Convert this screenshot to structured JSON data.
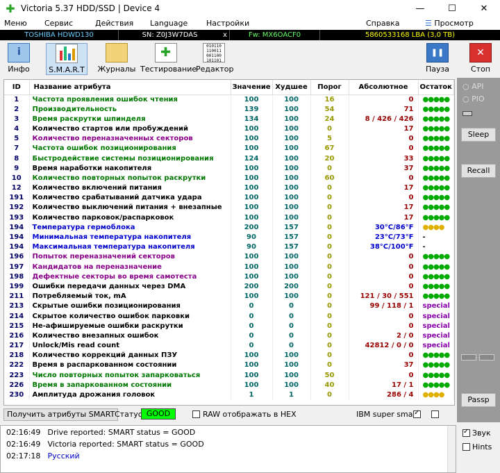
{
  "window": {
    "title": "Victoria 5.37 HDD/SSD | Device 4",
    "minimize": "—",
    "maximize": "☐",
    "close": "✕"
  },
  "menu": {
    "items": [
      "Меню",
      "Сервис",
      "Действия",
      "Language",
      "Настройки",
      "Справка"
    ],
    "buffer_view": "Просмотр буфера"
  },
  "info": {
    "model": "TOSHIBA HDWD130",
    "serial": "SN: Z0J3W7DAS",
    "x": "x",
    "firmware": "Fw: MX6OACF0",
    "lba": "5860533168 LBA (3,0 TB)"
  },
  "toolbar": {
    "info": "Инфо",
    "smart": "S.M.A.R.T",
    "logs": "Журналы",
    "testing": "Тестирование",
    "editor": "Редактор",
    "pause": "Пауза",
    "stop": "Стоп"
  },
  "table": {
    "headers": [
      "ID",
      "Название атрибута",
      "Значение",
      "Худшее",
      "Порог",
      "Абсолютное",
      "Остаток"
    ],
    "rows": [
      {
        "id": "1",
        "name": "Частота проявления ошибок чтения",
        "value": "100",
        "worst": "100",
        "thresh": "16",
        "abs": "0",
        "rest": "●●●●●",
        "name_color": "#007700",
        "rest_type": "green"
      },
      {
        "id": "2",
        "name": "Производительность",
        "value": "139",
        "worst": "100",
        "thresh": "54",
        "abs": "71",
        "rest": "●●●●●",
        "name_color": "#007700",
        "rest_type": "green"
      },
      {
        "id": "3",
        "name": "Время раскрутки шпинделя",
        "value": "134",
        "worst": "100",
        "thresh": "24",
        "abs": "8 / 426 / 426",
        "rest": "●●●●●",
        "name_color": "#007700",
        "rest_type": "green"
      },
      {
        "id": "4",
        "name": "Количество стартов или пробуждений",
        "value": "100",
        "worst": "100",
        "thresh": "0",
        "abs": "17",
        "rest": "●●●●●",
        "name_color": "#000000",
        "rest_type": "green"
      },
      {
        "id": "5",
        "name": "Количество переназначенных секторов",
        "value": "100",
        "worst": "100",
        "thresh": "5",
        "abs": "0",
        "rest": "●●●●●",
        "name_color": "#880088",
        "rest_type": "green"
      },
      {
        "id": "7",
        "name": "Частота ошибок позиционирования",
        "value": "100",
        "worst": "100",
        "thresh": "67",
        "abs": "0",
        "rest": "●●●●●",
        "name_color": "#007700",
        "rest_type": "green"
      },
      {
        "id": "8",
        "name": "Быстродействие системы позиционирования",
        "value": "124",
        "worst": "100",
        "thresh": "20",
        "abs": "33",
        "rest": "●●●●●",
        "name_color": "#007700",
        "rest_type": "green"
      },
      {
        "id": "9",
        "name": "Время наработки накопителя",
        "value": "100",
        "worst": "100",
        "thresh": "0",
        "abs": "37",
        "rest": "●●●●●",
        "name_color": "#000000",
        "rest_type": "green"
      },
      {
        "id": "10",
        "name": "Количество повторных попыток раскрутки",
        "value": "100",
        "worst": "100",
        "thresh": "60",
        "abs": "0",
        "rest": "●●●●●",
        "name_color": "#007700",
        "rest_type": "green"
      },
      {
        "id": "12",
        "name": "Количество включений питания",
        "value": "100",
        "worst": "100",
        "thresh": "0",
        "abs": "17",
        "rest": "●●●●●",
        "name_color": "#000000",
        "rest_type": "green"
      },
      {
        "id": "191",
        "name": "Количество срабатываний датчика удара",
        "value": "100",
        "worst": "100",
        "thresh": "0",
        "abs": "0",
        "rest": "●●●●●",
        "name_color": "#000000",
        "rest_type": "green"
      },
      {
        "id": "192",
        "name": "Количество выключений питания + внезапные",
        "value": "100",
        "worst": "100",
        "thresh": "0",
        "abs": "17",
        "rest": "●●●●●",
        "name_color": "#000000",
        "rest_type": "green"
      },
      {
        "id": "193",
        "name": "Количество парковок/распарковок",
        "value": "100",
        "worst": "100",
        "thresh": "0",
        "abs": "17",
        "rest": "●●●●●",
        "name_color": "#000000",
        "rest_type": "green"
      },
      {
        "id": "194",
        "name": "Температура гермоблока",
        "value": "200",
        "worst": "157",
        "thresh": "0",
        "abs": "30°C/86°F",
        "rest": "●●●●",
        "name_color": "#0000cc",
        "rest_type": "yellow",
        "abs_color": "#0000cc"
      },
      {
        "id": "194",
        "name": "Минимальная температура накопителя",
        "value": "90",
        "worst": "157",
        "thresh": "0",
        "abs": "23°C/73°F",
        "rest": "-",
        "name_color": "#0000cc",
        "rest_type": "plain",
        "abs_color": "#0000cc"
      },
      {
        "id": "194",
        "name": "Максимальная температура накопителя",
        "value": "90",
        "worst": "157",
        "thresh": "0",
        "abs": "38°C/100°F",
        "rest": "-",
        "name_color": "#0000cc",
        "rest_type": "plain",
        "abs_color": "#0000cc"
      },
      {
        "id": "196",
        "name": "Попыток переназначений секторов",
        "value": "100",
        "worst": "100",
        "thresh": "0",
        "abs": "0",
        "rest": "●●●●●",
        "name_color": "#880088",
        "rest_type": "green"
      },
      {
        "id": "197",
        "name": "Кандидатов на переназначение",
        "value": "100",
        "worst": "100",
        "thresh": "0",
        "abs": "0",
        "rest": "●●●●●",
        "name_color": "#880088",
        "rest_type": "green"
      },
      {
        "id": "198",
        "name": "Дефектные секторы во время самотеста",
        "value": "100",
        "worst": "100",
        "thresh": "0",
        "abs": "0",
        "rest": "●●●●●",
        "name_color": "#880088",
        "rest_type": "green"
      },
      {
        "id": "199",
        "name": "Ошибки передачи данных через DMA",
        "value": "200",
        "worst": "200",
        "thresh": "0",
        "abs": "0",
        "rest": "●●●●●",
        "name_color": "#000000",
        "rest_type": "green"
      },
      {
        "id": "211",
        "name": "Потребляемый ток, mA",
        "value": "100",
        "worst": "100",
        "thresh": "0",
        "abs": "121 / 30 / 551",
        "rest": "●●●●●",
        "name_color": "#000000",
        "rest_type": "green"
      },
      {
        "id": "213",
        "name": "Скрытые ошибки позиционирования",
        "value": "0",
        "worst": "0",
        "thresh": "0",
        "abs": "99 / 118 / 1",
        "rest": "special",
        "name_color": "#000000",
        "rest_type": "special"
      },
      {
        "id": "214",
        "name": "Скрытое количество ошибок парковки",
        "value": "0",
        "worst": "0",
        "thresh": "0",
        "abs": "0",
        "rest": "special",
        "name_color": "#000000",
        "rest_type": "special"
      },
      {
        "id": "215",
        "name": "Не-афишируемые ошибки раскрутки",
        "value": "0",
        "worst": "0",
        "thresh": "0",
        "abs": "0",
        "rest": "special",
        "name_color": "#000000",
        "rest_type": "special"
      },
      {
        "id": "216",
        "name": "Количество внезапных ошибок",
        "value": "0",
        "worst": "0",
        "thresh": "0",
        "abs": "2 / 0",
        "rest": "special",
        "name_color": "#000000",
        "rest_type": "special"
      },
      {
        "id": "217",
        "name": "Unlock/Mis read count",
        "value": "0",
        "worst": "0",
        "thresh": "0",
        "abs": "42812 / 0 / 0",
        "rest": "special",
        "name_color": "#000000",
        "rest_type": "special"
      },
      {
        "id": "218",
        "name": "Количество коррекций данных ПЗУ",
        "value": "100",
        "worst": "100",
        "thresh": "0",
        "abs": "0",
        "rest": "●●●●●",
        "name_color": "#000000",
        "rest_type": "green"
      },
      {
        "id": "222",
        "name": "Время в распаркованном состоянии",
        "value": "100",
        "worst": "100",
        "thresh": "0",
        "abs": "37",
        "rest": "●●●●●",
        "name_color": "#000000",
        "rest_type": "green"
      },
      {
        "id": "223",
        "name": "Число повторных попыток запарковаться",
        "value": "100",
        "worst": "100",
        "thresh": "50",
        "abs": "0",
        "rest": "●●●●●",
        "name_color": "#007700",
        "rest_type": "green"
      },
      {
        "id": "226",
        "name": "Время в запаркованном состоянии",
        "value": "100",
        "worst": "100",
        "thresh": "40",
        "abs": "17 / 1",
        "rest": "●●●●●",
        "name_color": "#007700",
        "rest_type": "green"
      },
      {
        "id": "230",
        "name": "Амплитуда дрожания головок",
        "value": "1",
        "worst": "1",
        "thresh": "0",
        "abs": "286 / 4",
        "rest": "●●●●",
        "name_color": "#000000",
        "rest_type": "yellow"
      }
    ]
  },
  "status_row": {
    "get_attrs_button": "Получить атрибуты SMART",
    "status_label": "Статус:",
    "status_value": "GOOD",
    "raw_hex_label": "RAW отображать в HEX",
    "ibm_label": "IBM super smart:"
  },
  "right_panel": {
    "api": "API",
    "pio": "PIO",
    "sleep": "Sleep",
    "recall": "Recall",
    "passp": "Passp"
  },
  "log": {
    "lines": [
      {
        "time": "02:16:49",
        "text": "Drive reported: SMART status = GOOD",
        "color": "#000000"
      },
      {
        "time": "02:16:49",
        "text": "Victoria reported: SMART status = GOOD",
        "color": "#000000"
      },
      {
        "time": "02:17:18",
        "text": "Русский",
        "color": "#0000cc"
      }
    ]
  },
  "bottom_right": {
    "sound": "Звук",
    "hints": "Hints"
  },
  "colors": {
    "status_good_bg": "#00ff00",
    "info_model": "#66ccff",
    "info_lba": "#ffff00"
  }
}
